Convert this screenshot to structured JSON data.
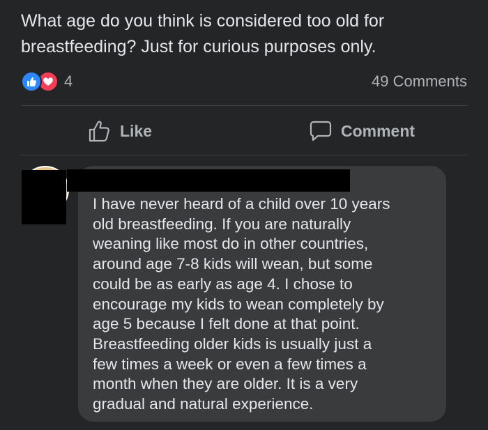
{
  "post": {
    "text": "What age do you think is considered too old for breastfeeding? Just for curious purposes only."
  },
  "reactions": {
    "icons": [
      "like-icon",
      "love-icon"
    ],
    "count": "4",
    "comments_count": "49 Comments",
    "like_color": "#2d88ff",
    "love_color": "#f33e58"
  },
  "actions": {
    "like_label": "Like",
    "comment_label": "Comment"
  },
  "comment": {
    "text": "I have never heard of a child over 10 years\nold breastfeeding. If you are naturally\nweaning like most do in other countries,\naround age 7-8 kids will wean, but some\ncould be as early as age 4. I chose to\nencourage my kids to wean completely by\nage 5 because I felt done at that point.\nBreastfeeding older kids is usually just a\nfew times a week or even a few times a\nmonth when they are older. It is a very\ngradual and natural experience."
  },
  "colors": {
    "background": "#242526",
    "bubble": "#3a3b3c",
    "text": "#e4e6eb",
    "muted": "#b0b3b8"
  }
}
